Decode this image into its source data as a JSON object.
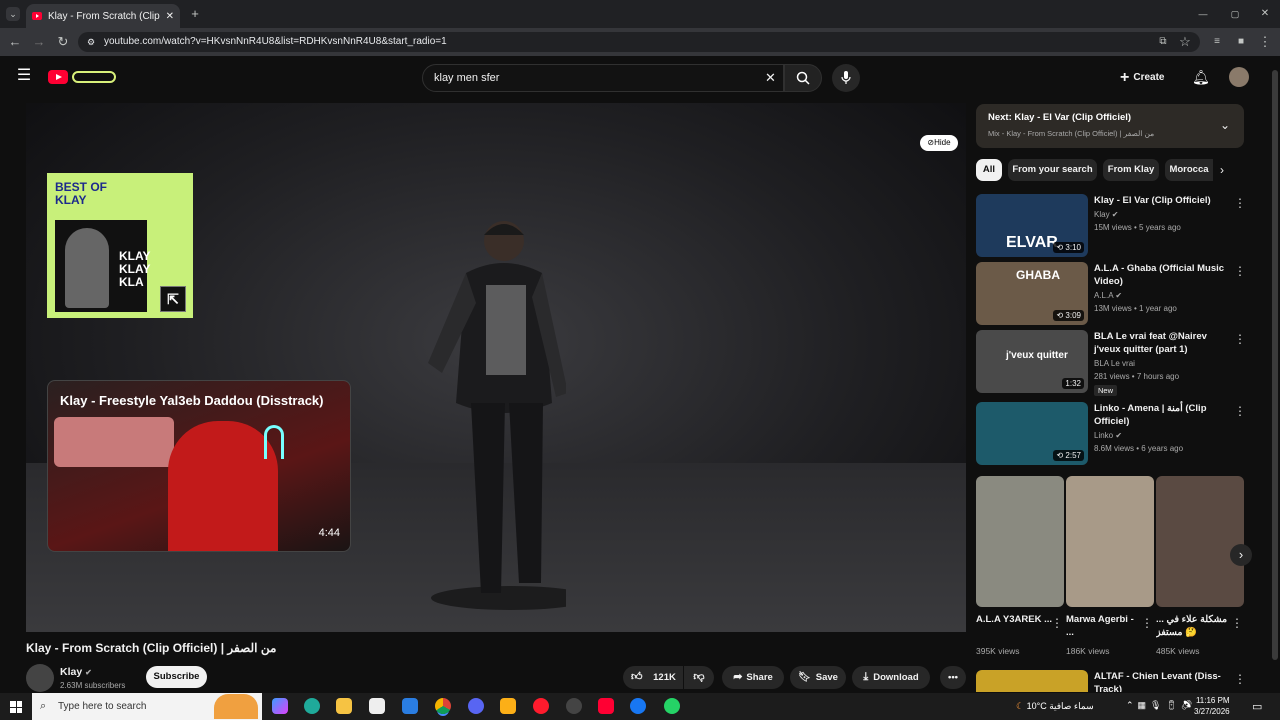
{
  "browser": {
    "tab_title": "Klay - From Scratch (Clip Officie",
    "url": "youtube.com/watch?v=HKvsnNnR4U8&list=RDHKvsnNnR4U8&start_radio=1"
  },
  "header": {
    "search_query": "klay men sfer",
    "create_label": "Create"
  },
  "player": {
    "hide_label": "Hide",
    "playlist_card": {
      "title_line1": "BEST OF",
      "title_line2": "KLAY",
      "art_text": "KLAY\nKLAY\nKLA"
    },
    "end_card": {
      "title": "Klay - Freestyle Yal3eb Daddou (Disstrack)",
      "duration": "4:44"
    }
  },
  "video": {
    "title": "Klay - From Scratch (Clip Officiel) | من الصفر",
    "channel": "Klay",
    "subscribers": "2.63M subscribers",
    "subscribe_label": "Subscribe",
    "likes": "121K",
    "share_label": "Share",
    "save_label": "Save",
    "download_label": "Download"
  },
  "sidebar": {
    "next_title": "Next: Klay - El Var (Clip Officiel)",
    "next_sub": "Mix - Klay - From Scratch (Clip Officiel) | من الصفر",
    "chips": [
      "All",
      "From your search",
      "From Klay",
      "Morocca"
    ],
    "recs": [
      {
        "title": "Klay - El Var (Clip Officiel)",
        "channel": "Klay",
        "meta": "15M views • 5 years ago",
        "duration": "3:10",
        "thumb_text": "ELVAR",
        "color": "#1e3a5c"
      },
      {
        "title": "A.L.A - Ghaba (Official Music Video)",
        "channel": "A.L.A",
        "meta": "13M views • 1 year ago",
        "duration": "3:09",
        "thumb_text": "GHABA",
        "color": "#6b5a48"
      },
      {
        "title": "BLA Le vrai feat @Nairev j'veux quitter (part 1)",
        "channel": "BLA Le vrai",
        "meta": "281 views • 7 hours ago",
        "badge": "New",
        "duration": "1:32",
        "thumb_text": "j'veux quitter",
        "color": "#4a4a4a"
      },
      {
        "title": "Linko - Amena | أمنة (Clip Officiel)",
        "channel": "Linko",
        "meta": "8.6M views • 6 years ago",
        "duration": "2:57",
        "thumb_text": "",
        "color": "#1d5a6a"
      }
    ],
    "shorts": [
      {
        "title": "A.L.A Y3AREK ...",
        "views": "395K views",
        "color": "#8a8a80"
      },
      {
        "title": "Marwa Agerbi - ...",
        "views": "186K views",
        "color": "#a89a88"
      },
      {
        "title": "مشكلة علاء في ... 🤔 مستفز",
        "views": "485K views",
        "color": "#5a4a42"
      }
    ],
    "last_rec": {
      "title": "ALTAF - Chien Levant (Diss-Track)"
    }
  },
  "taskbar": {
    "search_placeholder": "Type here to search",
    "weather": "10°C  سماء صافية",
    "time": "11:16 PM",
    "date": "3/27/2026"
  }
}
